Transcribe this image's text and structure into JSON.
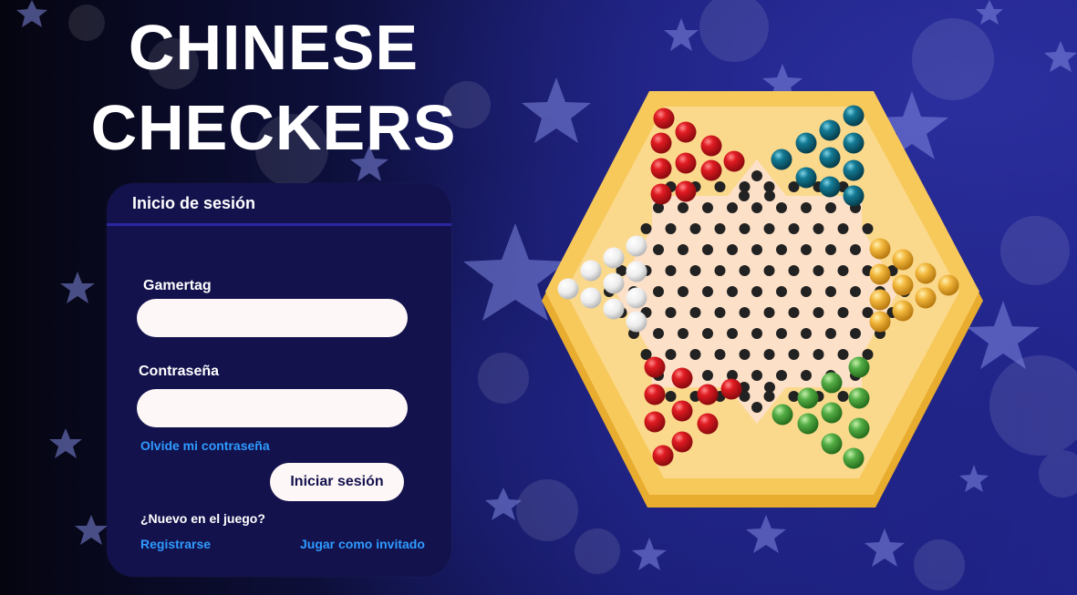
{
  "title": {
    "line1": "CHINESE",
    "line2": "CHECKERS"
  },
  "login": {
    "header": "Inicio de sesión",
    "gamertag_label": "Gamertag",
    "gamertag_value": "",
    "password_label": "Contraseña",
    "password_value": "",
    "forgot_link": "Olvide mi contraseña",
    "login_button": "Iniciar sesión",
    "new_prompt": "¿Nuevo en el juego?",
    "register_link": "Registrarse",
    "guest_link": "Jugar como invitado"
  },
  "colors": {
    "card_bg": "#13124d",
    "link": "#2f9bff",
    "board_wood": "#f7c95b",
    "board_inner": "#fbdca0",
    "hole": "#222222",
    "red": "#d8151b",
    "teal": "#0f6e86",
    "white": "#eeeeee",
    "yellow": "#f0b43a",
    "green": "#4ea845"
  },
  "icons": [
    "star-icon",
    "bokeh-circle"
  ]
}
